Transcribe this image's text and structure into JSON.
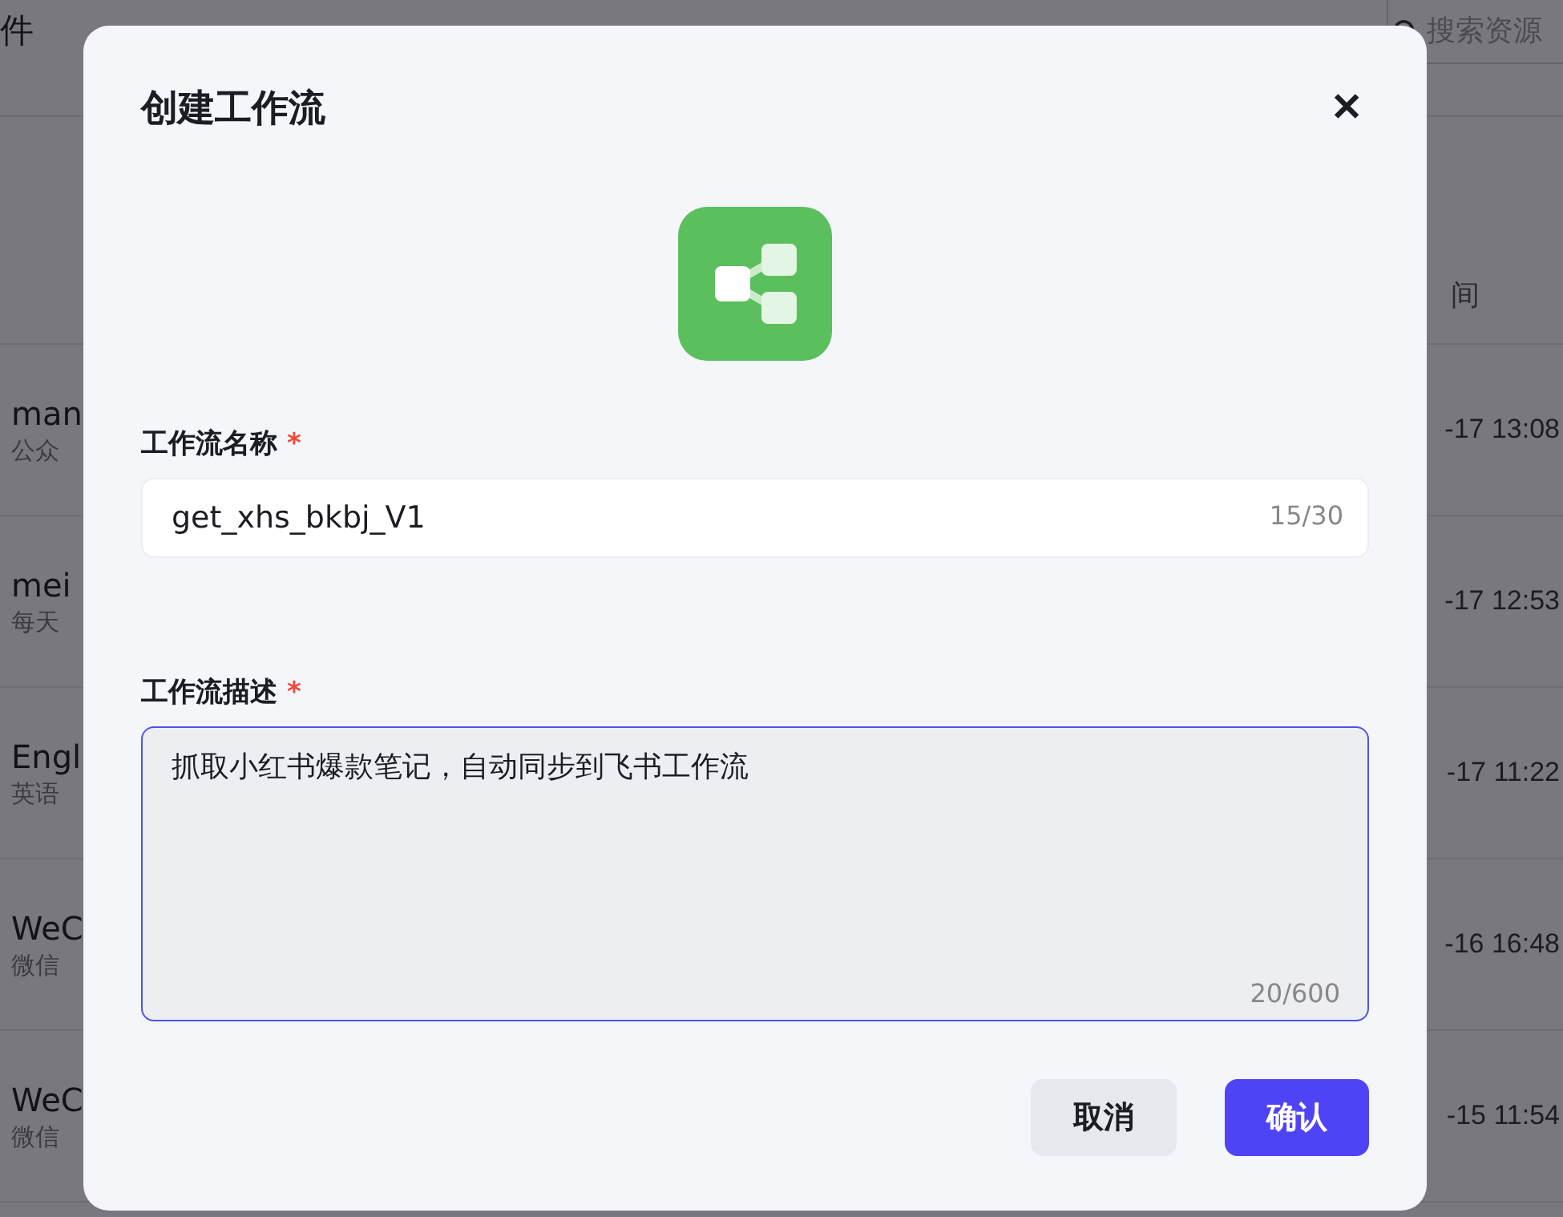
{
  "nav_tabs": [
    {
      "label": "件",
      "selected": false
    }
  ],
  "search": {
    "placeholder": "搜索资源"
  },
  "table": {
    "column_header": "间",
    "rows": [
      {
        "name": "man",
        "description": "公众",
        "time": "-17 13:08"
      },
      {
        "name": "mei",
        "description": "每天",
        "time": "-17 12:53"
      },
      {
        "name": "Engl",
        "description": "英语",
        "time": "-17 11:22"
      },
      {
        "name": "WeC",
        "description": "微信",
        "time": "-16 16:48"
      },
      {
        "name": "WeC",
        "description": "微信",
        "time": "-15 11:54"
      }
    ]
  },
  "dialog": {
    "title": "创建工作流",
    "close": "✕",
    "name_field": {
      "label": "工作流名称",
      "required_mark": "*",
      "value": "get_xhs_bkbj_V1",
      "counter": "15/30"
    },
    "description_field": {
      "label": "工作流描述",
      "required_mark": "*",
      "focused": true,
      "value": "抓取小红书爆款笔记，自动同步到飞书工作流",
      "counter": "20/600"
    },
    "buttons": [
      {
        "label": "取消",
        "kind": "secondary"
      },
      {
        "label": "确认",
        "kind": "primary"
      }
    ]
  }
}
